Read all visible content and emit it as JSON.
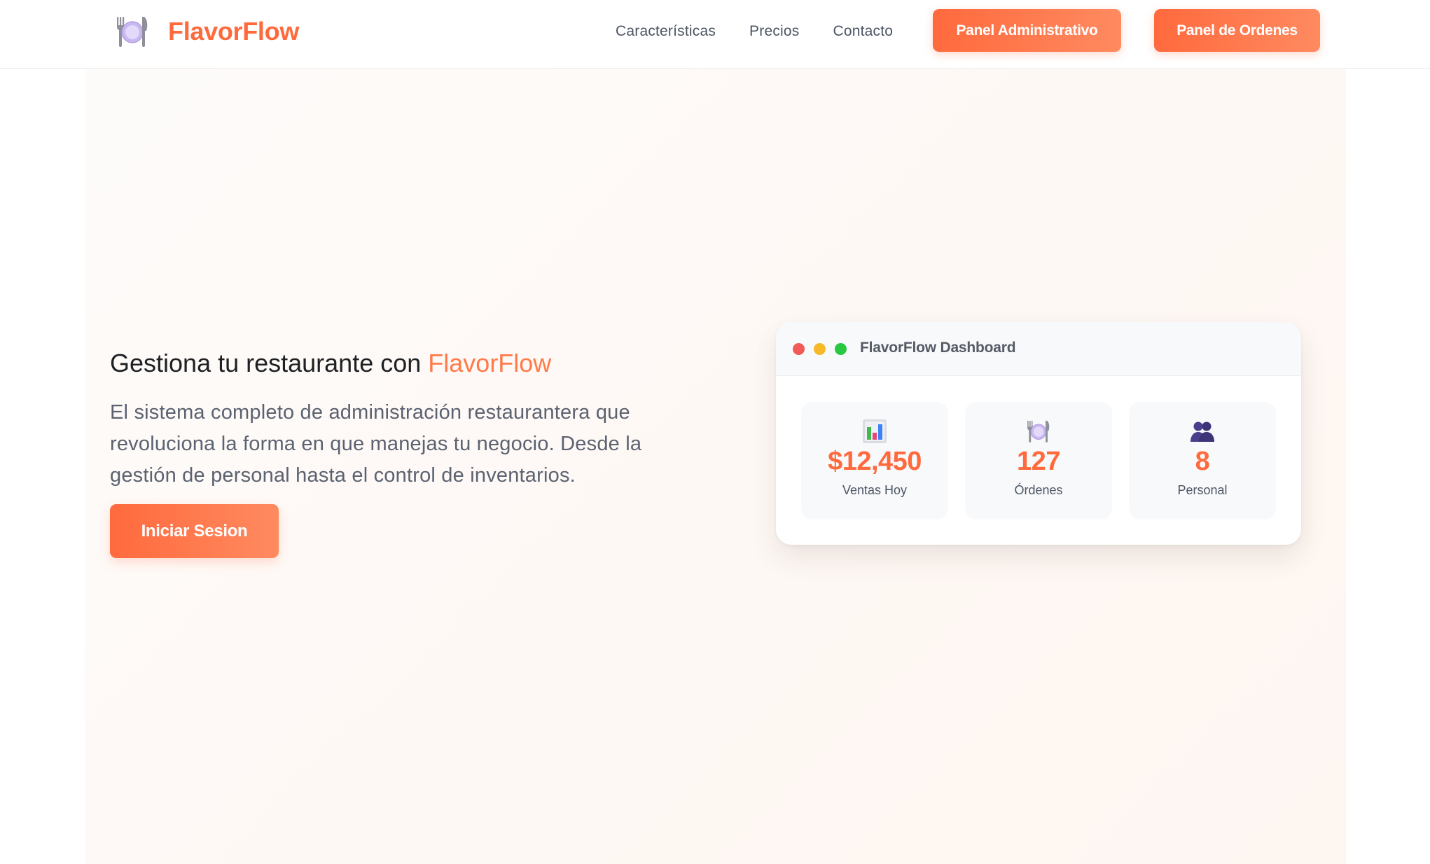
{
  "brand": {
    "name": "FlavorFlow",
    "color": "#ff6a3d",
    "logo_icon": "plate-with-cutlery-icon"
  },
  "nav": {
    "links": [
      "Características",
      "Precios",
      "Contacto"
    ],
    "buttons": {
      "admin_label": "Panel Administrativo",
      "orders_label": "Panel de Ordenes"
    }
  },
  "hero": {
    "title_prefix": "Gestiona tu restaurante con ",
    "title_accent": "FlavorFlow",
    "description": "El sistema completo de administración restaurantera que revoluciona la forma en que manejas tu negocio. Desde la gestión de personal hasta el control de inventarios.",
    "cta_label": "Iniciar Sesion"
  },
  "dashboard": {
    "title": "FlavorFlow Dashboard",
    "window_dots": [
      "#f25a57",
      "#f7b928",
      "#28c840"
    ],
    "stats": [
      {
        "icon": "bar-chart-icon",
        "value": "$12,450",
        "label": "Ventas Hoy"
      },
      {
        "icon": "plate-with-cutlery-icon",
        "value": "127",
        "label": "Órdenes"
      },
      {
        "icon": "people-icon",
        "value": "8",
        "label": "Personal"
      }
    ]
  }
}
